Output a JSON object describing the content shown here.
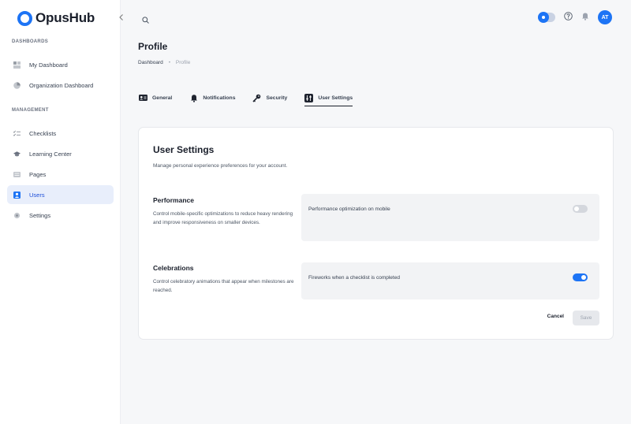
{
  "app": {
    "name": "OpusHub"
  },
  "sidebar": {
    "sections": [
      {
        "label": "DASHBOARDS"
      },
      {
        "label": "MANAGEMENT"
      }
    ],
    "items": [
      {
        "label": "My Dashboard",
        "icon": "dashboard-icon"
      },
      {
        "label": "Organization Dashboard",
        "icon": "org-dashboard-icon"
      },
      {
        "label": "Checklists",
        "icon": "checklist-icon"
      },
      {
        "label": "Learning Center",
        "icon": "graduation-cap-icon"
      },
      {
        "label": "Pages",
        "icon": "pages-icon"
      },
      {
        "label": "Users",
        "icon": "user-icon",
        "active": true
      },
      {
        "label": "Settings",
        "icon": "gear-icon"
      }
    ]
  },
  "topbar": {
    "avatar_initials": "AT"
  },
  "header": {
    "title": "Profile",
    "breadcrumb": {
      "home": "Dashboard",
      "current": "Profile"
    }
  },
  "tabs": [
    {
      "label": "General",
      "icon": "id-card-icon"
    },
    {
      "label": "Notifications",
      "icon": "bell-icon"
    },
    {
      "label": "Security",
      "icon": "key-icon"
    },
    {
      "label": "User Settings",
      "icon": "settings-sliders-icon",
      "active": true
    }
  ],
  "card": {
    "title": "User Settings",
    "subtitle": "Manage personal experience preferences for your account.",
    "sections": [
      {
        "title": "Performance",
        "description": "Control mobile-specific optimizations to reduce heavy rendering and improve responsiveness on smaller devices.",
        "setting_label": "Performance optimization on mobile",
        "enabled": false
      },
      {
        "title": "Celebrations",
        "description": "Control celebratory animations that appear when milestones are reached.",
        "setting_label": "Fireworks when a checklist is completed",
        "enabled": true
      }
    ],
    "cancel_label": "Cancel",
    "save_label": "Save"
  },
  "colors": {
    "accent": "#1d74f5",
    "active_nav_bg": "#e8eefb"
  }
}
